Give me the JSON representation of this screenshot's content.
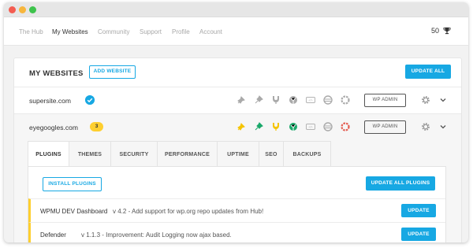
{
  "nav": {
    "items": [
      "The Hub",
      "My Websites",
      "Community",
      "Support",
      "Profile",
      "Account"
    ],
    "active": "My Websites",
    "points": "50"
  },
  "websites": {
    "title": "MY WEBSITES",
    "add_label": "ADD WEBSITE",
    "update_all_label": "UPDATE ALL",
    "sites": [
      {
        "name": "supersite.com",
        "badge": "verified",
        "wp_admin": "WP ADMIN",
        "icon_color": "#aaaaaa"
      },
      {
        "name": "eyegoogles.com",
        "badge": "3",
        "wp_admin": "WP ADMIN",
        "icon_color": "#f5c400"
      }
    ],
    "service_icons": [
      "defender-icon",
      "pin-icon",
      "shield-badge-icon",
      "globe-leaf-icon",
      "code-icon",
      "backup-icon",
      "snapshot-icon"
    ],
    "accent": "#17a8e3",
    "highlight": "#fecf2f"
  },
  "tabs": [
    "PLUGINS",
    "THEMES",
    "SECURITY",
    "PERFORMANCE",
    "UPTIME",
    "SEO",
    "BACKUPS"
  ],
  "plugins": {
    "install_label": "INSTALL PLUGINS",
    "update_all_label": "UPDATE ALL PLUGINS",
    "rows": [
      {
        "name": "WPMU DEV Dashboard",
        "description": "v 4.2 - Add support for wp.org repo updates from Hub!",
        "update_label": "UPDATE"
      },
      {
        "name": "Defender",
        "description": "v 1.1.3 -  Improvement: Audit Logging now ajax based.",
        "update_label": "UPDATE"
      }
    ]
  }
}
